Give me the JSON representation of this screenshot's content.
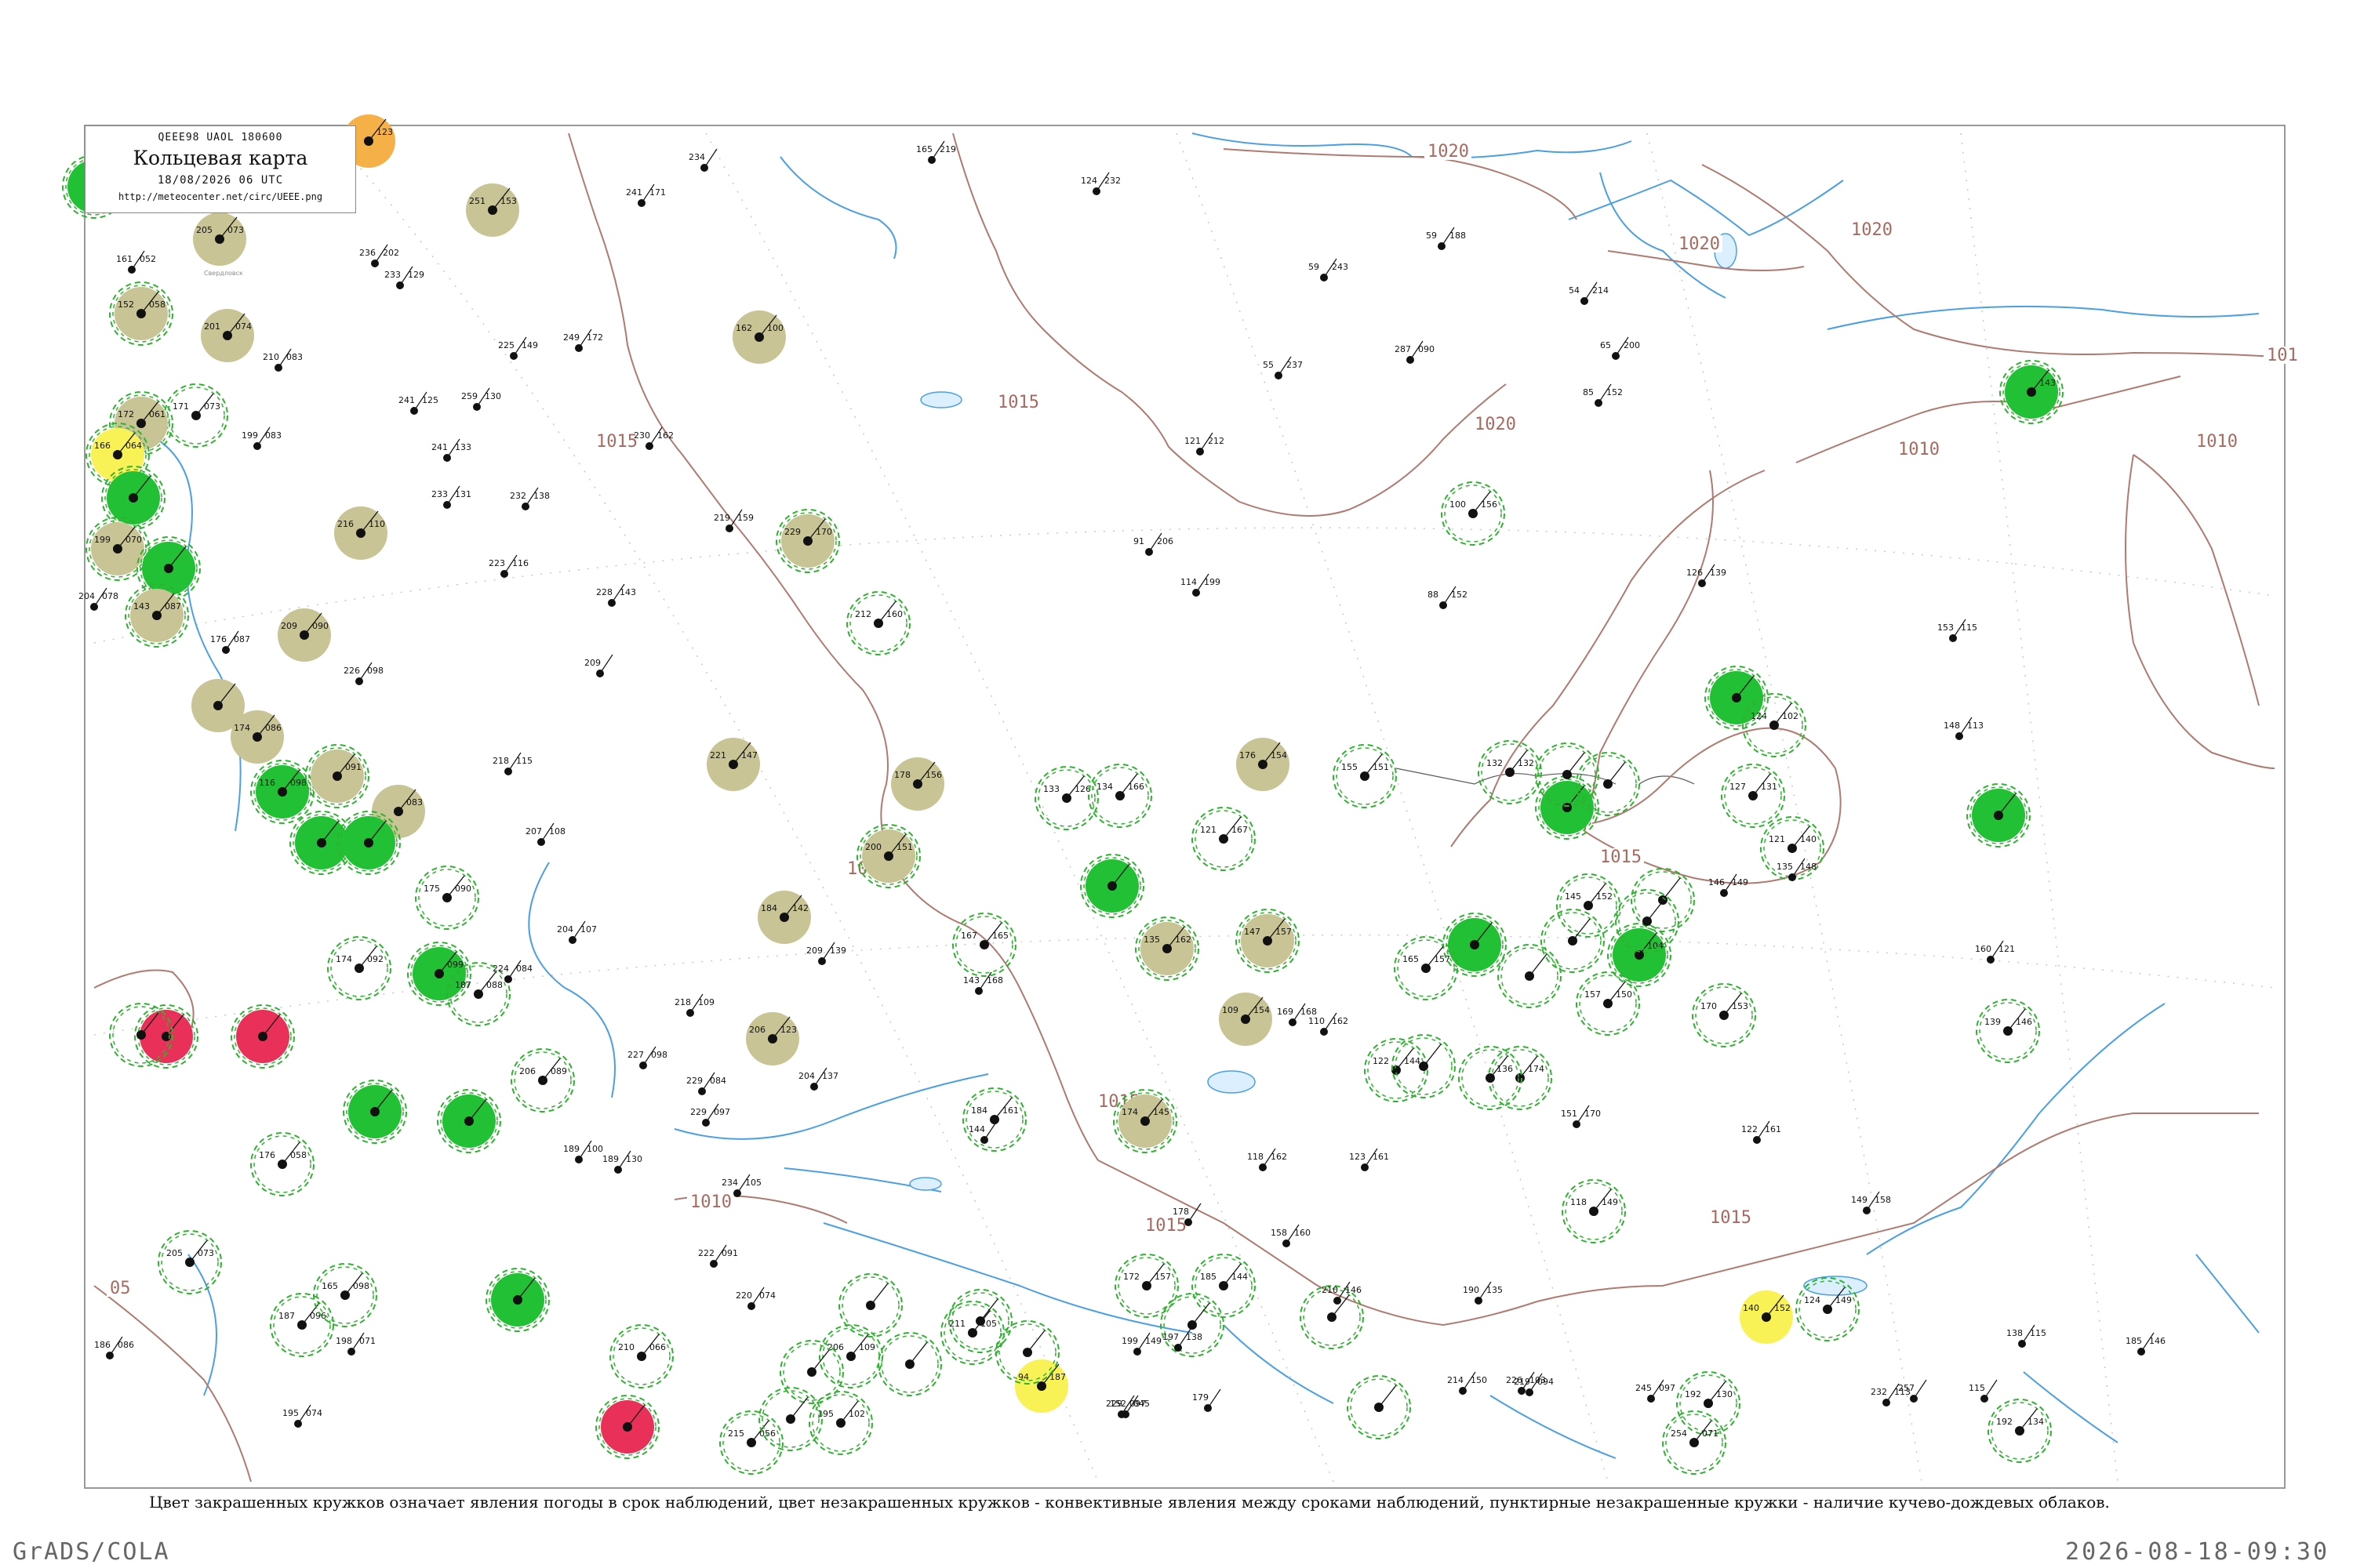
{
  "legend": {
    "header": "QEEE98  UAOL  180600",
    "title": "Кольцевая карта",
    "date": "18/08/2026 06 UTC",
    "url": "http://meteocenter.net/circ/UEEE.png"
  },
  "caption": "Цвет закрашенных кружков означает явления погоды в срок наблюдений, цвет незакрашенных кружков - конвективные явления между сроками наблюдений, пунктирные незакрашенные кружки - наличие кучево-дождевых облаков.",
  "footer": {
    "left": "GrADS/COLA",
    "right": "2026-08-18-09:30"
  },
  "isobar_labels": [
    "1020",
    "1020",
    "1020",
    "1020",
    "1015",
    "1015",
    "1015",
    "1015",
    "1015",
    "1010",
    "1010",
    "1010",
    "101",
    "05",
    "1015",
    "1015"
  ],
  "colors": {
    "isobar": "#b07a70",
    "water": "#4a9fe6",
    "frame": "#999999",
    "fill_rain": "#22c034",
    "fill_fog": "#c8c495",
    "fill_thunder": "#e83058",
    "fill_haze": "#f8f256",
    "fill_orange": "#f5b048",
    "dashed_circle": "#2fb22f"
  },
  "stations": [
    {
      "fill": "rain",
      "ring": "dashed",
      "label": "",
      "temp": "",
      "press": ""
    },
    {
      "fill": "fog",
      "ring": "none",
      "label": "Свердловск",
      "temp": "205",
      "press": "073"
    },
    {
      "fill": "fog",
      "ring": "dashed",
      "label": "",
      "temp": "152",
      "press": "058"
    },
    {
      "fill": "fog",
      "ring": "none",
      "label": "",
      "temp": "201",
      "press": "074"
    },
    {
      "fill": "none",
      "ring": "dashed",
      "label": "",
      "temp": "171",
      "press": "073"
    },
    {
      "fill": "fog",
      "ring": "dashed",
      "label": "",
      "temp": "172",
      "press": "061"
    },
    {
      "fill": "haze",
      "ring": "dashed",
      "label": "",
      "temp": "166",
      "press": "064"
    },
    {
      "fill": "rain",
      "ring": "dashed",
      "label": "",
      "temp": "",
      "press": ""
    },
    {
      "fill": "fog",
      "ring": "dashed",
      "label": "",
      "temp": "199",
      "press": "070"
    },
    {
      "fill": "rain",
      "ring": "dashed",
      "label": "",
      "temp": "",
      "press": ""
    },
    {
      "fill": "fog",
      "ring": "dashed",
      "label": "",
      "temp": "143",
      "press": "087"
    },
    {
      "fill": "fog",
      "ring": "none",
      "label": "",
      "temp": "216",
      "press": "110"
    },
    {
      "fill": "fog",
      "ring": "none",
      "label": "",
      "temp": "251",
      "press": "153"
    },
    {
      "fill": "fog",
      "ring": "none",
      "label": "",
      "temp": "209",
      "press": "090"
    },
    {
      "fill": "fog",
      "ring": "none",
      "label": "",
      "temp": "162",
      "press": "100"
    },
    {
      "fill": "fog",
      "ring": "dashed",
      "label": "",
      "temp": "229",
      "press": "170"
    },
    {
      "fill": "none",
      "ring": "dashed",
      "label": "",
      "temp": "212",
      "press": "160"
    },
    {
      "fill": "fog",
      "ring": "none",
      "label": "",
      "temp": "",
      "press": ""
    },
    {
      "fill": "fog",
      "ring": "none",
      "label": "",
      "temp": "174",
      "press": "086"
    },
    {
      "fill": "rain",
      "ring": "dashed",
      "label": "",
      "temp": "116",
      "press": "098"
    },
    {
      "fill": "fog",
      "ring": "dashed",
      "label": "",
      "temp": "",
      "press": "091"
    },
    {
      "fill": "fog",
      "ring": "none",
      "label": "",
      "temp": "",
      "press": "083"
    },
    {
      "fill": "rain",
      "ring": "dashed",
      "label": "",
      "temp": "",
      "press": ""
    },
    {
      "fill": "rain",
      "ring": "dashed",
      "label": "",
      "temp": "",
      "press": ""
    },
    {
      "fill": "fog",
      "ring": "none",
      "label": "",
      "temp": "221",
      "press": "147"
    },
    {
      "fill": "fog",
      "ring": "none",
      "label": "",
      "temp": "178",
      "press": "156"
    },
    {
      "fill": "fog",
      "ring": "dashed",
      "label": "",
      "temp": "200",
      "press": "151"
    },
    {
      "fill": "fog",
      "ring": "none",
      "label": "",
      "temp": "184",
      "press": "142"
    },
    {
      "fill": "fog",
      "ring": "none",
      "label": "",
      "temp": "206",
      "press": "123"
    },
    {
      "fill": "thunder",
      "ring": "dashed",
      "label": "",
      "temp": "",
      "press": ""
    },
    {
      "fill": "thunder",
      "ring": "dashed",
      "label": "",
      "temp": "",
      "press": ""
    },
    {
      "fill": "rain",
      "ring": "dashed",
      "label": "",
      "temp": "",
      "press": "099"
    },
    {
      "fill": "rain",
      "ring": "dashed",
      "label": "",
      "temp": "",
      "press": ""
    },
    {
      "fill": "rain",
      "ring": "dashed",
      "label": "",
      "temp": "",
      "press": ""
    },
    {
      "fill": "rain",
      "ring": "dashed",
      "label": "",
      "temp": "",
      "press": ""
    },
    {
      "fill": "thunder",
      "ring": "dashed",
      "label": "",
      "temp": "",
      "press": ""
    },
    {
      "fill": "haze",
      "ring": "none",
      "label": "",
      "temp": "94",
      "press": "187"
    },
    {
      "fill": "rain",
      "ring": "dashed",
      "label": "",
      "temp": "",
      "press": ""
    },
    {
      "fill": "fog",
      "ring": "dashed",
      "label": "",
      "temp": "135",
      "press": "162"
    },
    {
      "fill": "fog",
      "ring": "none",
      "label": "",
      "temp": "109",
      "press": "154"
    },
    {
      "fill": "fog",
      "ring": "dashed",
      "label": "",
      "temp": "147",
      "press": "157"
    },
    {
      "fill": "fog",
      "ring": "none",
      "label": "",
      "temp": "176",
      "press": "154"
    },
    {
      "fill": "fog",
      "ring": "dashed",
      "label": "",
      "temp": "174",
      "press": "145"
    },
    {
      "fill": "rain",
      "ring": "dashed",
      "label": "",
      "temp": "",
      "press": ""
    },
    {
      "fill": "rain",
      "ring": "dashed",
      "label": "",
      "temp": "",
      "press": ""
    },
    {
      "fill": "rain",
      "ring": "dashed",
      "label": "",
      "temp": "",
      "press": "104"
    },
    {
      "fill": "rain",
      "ring": "dashed",
      "label": "",
      "temp": "",
      "press": "143"
    },
    {
      "fill": "rain",
      "ring": "dashed",
      "label": "",
      "temp": "",
      "press": ""
    },
    {
      "fill": "rain",
      "ring": "dashed",
      "label": "",
      "temp": "",
      "press": ""
    },
    {
      "fill": "haze",
      "ring": "none",
      "label": "",
      "temp": "140",
      "press": "152"
    },
    {
      "fill": "orange",
      "ring": "none",
      "label": "",
      "temp": "",
      "press": "123"
    },
    {
      "fill": "none",
      "ring": "dashed",
      "label": "",
      "temp": "133",
      "press": "126"
    },
    {
      "fill": "none",
      "ring": "dashed",
      "label": "",
      "temp": "134",
      "press": "166"
    },
    {
      "fill": "none",
      "ring": "dashed",
      "label": "",
      "temp": "121",
      "press": "167"
    },
    {
      "fill": "none",
      "ring": "dashed",
      "label": "",
      "temp": "167",
      "press": "165"
    },
    {
      "fill": "none",
      "ring": "dashed",
      "label": "",
      "temp": "184",
      "press": "161"
    },
    {
      "fill": "none",
      "ring": "dashed",
      "label": "",
      "temp": "172",
      "press": "157"
    },
    {
      "fill": "none",
      "ring": "dashed",
      "label": "",
      "temp": "185",
      "press": "144"
    },
    {
      "fill": "none",
      "ring": "dashed",
      "label": "",
      "temp": "211",
      "press": "105"
    },
    {
      "fill": "none",
      "ring": "dashed",
      "label": "",
      "temp": "206",
      "press": "109"
    },
    {
      "fill": "none",
      "ring": "dashed",
      "label": "",
      "temp": "195",
      "press": "102"
    },
    {
      "fill": "none",
      "ring": "dashed",
      "label": "",
      "temp": "215",
      "press": "056"
    },
    {
      "fill": "none",
      "ring": "dashed",
      "label": "",
      "temp": "210",
      "press": "066"
    },
    {
      "fill": "none",
      "ring": "dashed",
      "label": "",
      "temp": "205",
      "press": "073"
    },
    {
      "fill": "none",
      "ring": "dashed",
      "label": "",
      "temp": "187",
      "press": "096"
    },
    {
      "fill": "none",
      "ring": "dashed",
      "label": "",
      "temp": "165",
      "press": "098"
    },
    {
      "fill": "none",
      "ring": "dashed",
      "label": "",
      "temp": "176",
      "press": "058"
    },
    {
      "fill": "none",
      "ring": "dashed",
      "label": "",
      "temp": "174",
      "press": "092"
    },
    {
      "fill": "none",
      "ring": "dashed",
      "label": "",
      "temp": "175",
      "press": "090"
    },
    {
      "fill": "none",
      "ring": "dashed",
      "label": "",
      "temp": "187",
      "press": "088"
    },
    {
      "fill": "none",
      "ring": "dashed",
      "label": "",
      "temp": "206",
      "press": "089"
    },
    {
      "fill": "none",
      "ring": "dashed",
      "label": "",
      "temp": "155",
      "press": "151"
    },
    {
      "fill": "none",
      "ring": "dashed",
      "label": "",
      "temp": "100",
      "press": "156"
    },
    {
      "fill": "none",
      "ring": "dashed",
      "label": "",
      "temp": "165",
      "press": "157"
    },
    {
      "fill": "none",
      "ring": "dashed",
      "label": "",
      "temp": "136",
      "press": "174"
    },
    {
      "fill": "none",
      "ring": "dashed",
      "label": "",
      "temp": "157",
      "press": "150"
    },
    {
      "fill": "none",
      "ring": "dashed",
      "label": "",
      "temp": "170",
      "press": "153"
    },
    {
      "fill": "none",
      "ring": "dashed",
      "label": "",
      "temp": "145",
      "press": "152"
    },
    {
      "fill": "none",
      "ring": "dashed",
      "label": "",
      "temp": "132",
      "press": "132"
    },
    {
      "fill": "none",
      "ring": "dashed",
      "label": "",
      "temp": "124",
      "press": "102"
    },
    {
      "fill": "none",
      "ring": "dashed",
      "label": "",
      "temp": "127",
      "press": "131"
    },
    {
      "fill": "none",
      "ring": "dashed",
      "label": "",
      "temp": "121",
      "press": "140"
    },
    {
      "fill": "none",
      "ring": "dashed",
      "label": "",
      "temp": "139",
      "press": "146"
    },
    {
      "fill": "none",
      "ring": "dashed",
      "label": "",
      "temp": "192",
      "press": "130"
    },
    {
      "fill": "none",
      "ring": "dashed",
      "label": "",
      "temp": "254",
      "press": "071"
    },
    {
      "fill": "none",
      "ring": "dashed",
      "label": "",
      "temp": "118",
      "press": "149"
    },
    {
      "fill": "none",
      "ring": "dashed",
      "label": "",
      "temp": "124",
      "press": "149"
    },
    {
      "fill": "none",
      "ring": "dashed",
      "label": "",
      "temp": "192",
      "press": "134"
    },
    {
      "fill": "none",
      "ring": "dashed",
      "label": "",
      "temp": "122",
      "press": "144"
    },
    {
      "fill": "none",
      "ring": "dashed",
      "label": "",
      "temp": "",
      "press": ""
    },
    {
      "fill": "none",
      "ring": "dashed",
      "label": "",
      "temp": "",
      "press": ""
    },
    {
      "fill": "none",
      "ring": "dashed",
      "label": "",
      "temp": "",
      "press": ""
    },
    {
      "fill": "none",
      "ring": "dashed",
      "label": "",
      "temp": "",
      "press": ""
    },
    {
      "fill": "none",
      "ring": "dashed",
      "label": "",
      "temp": "",
      "press": ""
    },
    {
      "fill": "none",
      "ring": "dashed",
      "label": "",
      "temp": "",
      "press": ""
    },
    {
      "fill": "none",
      "ring": "dashed",
      "label": "",
      "temp": "",
      "press": ""
    },
    {
      "fill": "none",
      "ring": "dashed",
      "label": "",
      "temp": "",
      "press": ""
    },
    {
      "fill": "none",
      "ring": "dashed",
      "label": "",
      "temp": "",
      "press": ""
    },
    {
      "fill": "none",
      "ring": "dashed",
      "label": "",
      "temp": "",
      "press": ""
    },
    {
      "fill": "none",
      "ring": "dashed",
      "label": "",
      "temp": "",
      "press": ""
    },
    {
      "fill": "none",
      "ring": "dashed",
      "label": "",
      "temp": "",
      "press": ""
    },
    {
      "fill": "none",
      "ring": "dashed",
      "label": "",
      "temp": "",
      "press": ""
    },
    {
      "fill": "none",
      "ring": "dashed",
      "label": "",
      "temp": "",
      "press": ""
    },
    {
      "fill": "none",
      "ring": "dashed",
      "label": "",
      "temp": "",
      "press": ""
    },
    {
      "fill": "none",
      "ring": "dashed",
      "label": "",
      "temp": "",
      "press": ""
    },
    {
      "fill": "none",
      "ring": "dashed",
      "label": "",
      "temp": "",
      "press": ""
    },
    {
      "fill": "none",
      "ring": "dashed",
      "label": "",
      "temp": "",
      "press": ""
    }
  ],
  "plain_stations": [
    {
      "temp": "161",
      "press": "052"
    },
    {
      "temp": "210",
      "press": "083"
    },
    {
      "temp": "199",
      "press": "083"
    },
    {
      "temp": "233",
      "press": "129"
    },
    {
      "temp": "236",
      "press": "202"
    },
    {
      "temp": "241",
      "press": "171"
    },
    {
      "temp": "234",
      "press": ""
    },
    {
      "temp": "225",
      "press": "149"
    },
    {
      "temp": "249",
      "press": "172"
    },
    {
      "temp": "241",
      "press": "125"
    },
    {
      "temp": "259",
      "press": "130"
    },
    {
      "temp": "241",
      "press": "133"
    },
    {
      "temp": "230",
      "press": "162"
    },
    {
      "temp": "233",
      "press": "131"
    },
    {
      "temp": "232",
      "press": "138"
    },
    {
      "temp": "223",
      "press": "116"
    },
    {
      "temp": "228",
      "press": "143"
    },
    {
      "temp": "209",
      "press": ""
    },
    {
      "temp": "219",
      "press": "159"
    },
    {
      "temp": "165",
      "press": "219"
    },
    {
      "temp": "124",
      "press": "232"
    },
    {
      "temp": "59",
      "press": "188"
    },
    {
      "temp": "59",
      "press": "243"
    },
    {
      "temp": "54",
      "press": "214"
    },
    {
      "temp": "65",
      "press": "200"
    },
    {
      "temp": "85",
      "press": "152"
    },
    {
      "temp": "55",
      "press": "237"
    },
    {
      "temp": "287",
      "press": "090"
    },
    {
      "temp": "121",
      "press": "212"
    },
    {
      "temp": "91",
      "press": "206"
    },
    {
      "temp": "114",
      "press": "199"
    },
    {
      "temp": "126",
      "press": "139"
    },
    {
      "temp": "88",
      "press": "152"
    },
    {
      "temp": "153",
      "press": "115"
    },
    {
      "temp": "204",
      "press": "078"
    },
    {
      "temp": "176",
      "press": "087"
    },
    {
      "temp": "226",
      "press": "098"
    },
    {
      "temp": "218",
      "press": "115"
    },
    {
      "temp": "207",
      "press": "108"
    },
    {
      "temp": "204",
      "press": "107"
    },
    {
      "temp": "224",
      "press": "084"
    },
    {
      "temp": "218",
      "press": "109"
    },
    {
      "temp": "227",
      "press": "098"
    },
    {
      "temp": "229",
      "press": "084"
    },
    {
      "temp": "204",
      "press": "137"
    },
    {
      "temp": "209",
      "press": "139"
    },
    {
      "temp": "143",
      "press": "168"
    },
    {
      "temp": "144",
      "press": ""
    },
    {
      "temp": "189",
      "press": "100"
    },
    {
      "temp": "189",
      "press": "130"
    },
    {
      "temp": "222",
      "press": "091"
    },
    {
      "temp": "229",
      "press": "097"
    },
    {
      "temp": "234",
      "press": "105"
    },
    {
      "temp": "220",
      "press": "074"
    },
    {
      "temp": "198",
      "press": "071"
    },
    {
      "temp": "186",
      "press": "086"
    },
    {
      "temp": "195",
      "press": "074"
    },
    {
      "temp": "178",
      "press": ""
    },
    {
      "temp": "158",
      "press": "160"
    },
    {
      "temp": "123",
      "press": "161"
    },
    {
      "temp": "118",
      "press": "162"
    },
    {
      "temp": "169",
      "press": "168"
    },
    {
      "temp": "110",
      "press": "162"
    },
    {
      "temp": "146",
      "press": "149"
    },
    {
      "temp": "135",
      "press": "148"
    },
    {
      "temp": "160",
      "press": "121"
    },
    {
      "temp": "151",
      "press": "170"
    },
    {
      "temp": "122",
      "press": "161"
    },
    {
      "temp": "149",
      "press": "158"
    },
    {
      "temp": "190",
      "press": "135"
    },
    {
      "temp": "214",
      "press": "150"
    },
    {
      "temp": "226",
      "press": "103"
    },
    {
      "temp": "232",
      "press": "113"
    },
    {
      "temp": "245",
      "press": "097"
    },
    {
      "temp": "219",
      "press": "094"
    },
    {
      "temp": "257",
      "press": ""
    },
    {
      "temp": "115",
      "press": ""
    },
    {
      "temp": "138",
      "press": "115"
    },
    {
      "temp": "185",
      "press": "146"
    },
    {
      "temp": "148",
      "press": "113"
    },
    {
      "temp": "210",
      "press": "146"
    },
    {
      "temp": "199",
      "press": "149"
    },
    {
      "temp": "197",
      "press": "138"
    },
    {
      "temp": "179",
      "press": ""
    },
    {
      "temp": "229",
      "press": "097"
    },
    {
      "temp": "152",
      "press": "045"
    },
    {
      "temp": "229",
      "press": "097"
    }
  ]
}
